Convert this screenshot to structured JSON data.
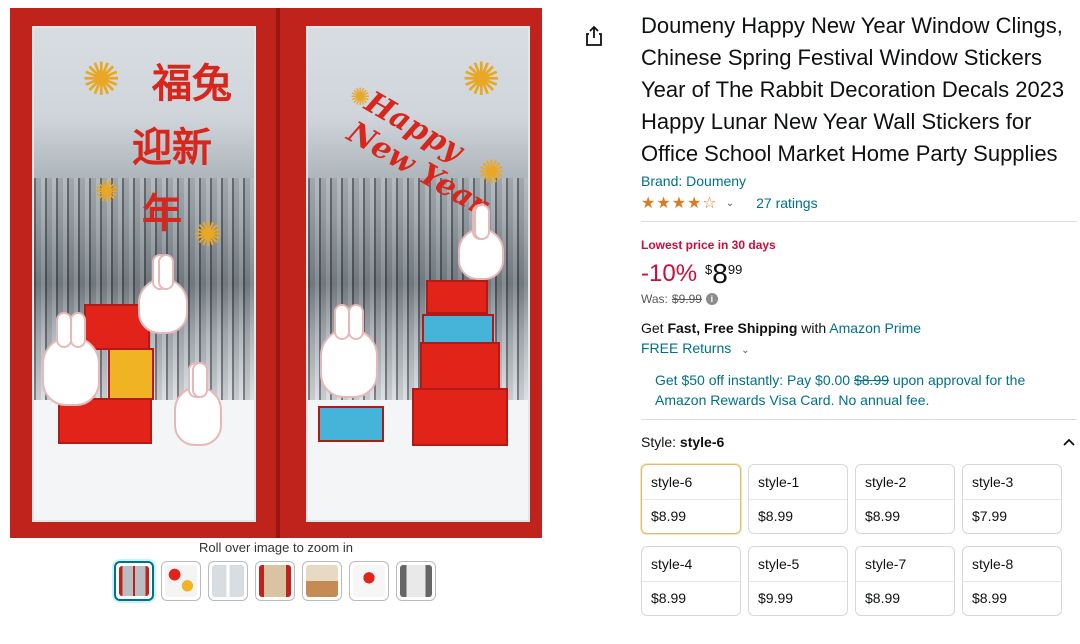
{
  "product": {
    "title": "Doumeny Happy New Year Window Clings, Chinese Spring Festival Window Stickers Year of The Rabbit Decoration Decals 2023 Happy Lunar New Year Wall Stickers for Office School Market Home Party Supplies",
    "brand": "Brand: Doumeny",
    "rating_stars": "★★★★☆",
    "rating_value": 4.3,
    "ratings_count": "27 ratings"
  },
  "gallery": {
    "zoom_caption": "Roll over image to zoom in",
    "left_door_text_1": "福兔",
    "left_door_text_2": "迎新",
    "left_door_text_3": "年",
    "right_door_text": "Happy New Year",
    "thumbnails": [
      "thumb-1",
      "thumb-2",
      "thumb-3",
      "thumb-4",
      "thumb-5",
      "thumb-6",
      "thumb-7"
    ]
  },
  "pricing": {
    "deal_label": "Lowest price in 30 days",
    "discount": "-10%",
    "currency": "$",
    "whole": "8",
    "fraction": "99",
    "was_label": "Was:",
    "was_price": "$9.99"
  },
  "shipping": {
    "prefix": "Get ",
    "bold": "Fast, Free Shipping",
    "middle": " with ",
    "prime_link": "Amazon Prime",
    "returns": "FREE Returns"
  },
  "promo": {
    "part1": "Get $50 off instantly: Pay $0.00 ",
    "strike": "$8.99",
    "part2": " upon approval for the Amazon Rewards Visa Card. No annual fee."
  },
  "style": {
    "label": "Style: ",
    "selected": "style-6",
    "options": [
      {
        "name": "style-6",
        "price": "$8.99"
      },
      {
        "name": "style-1",
        "price": "$8.99"
      },
      {
        "name": "style-2",
        "price": "$8.99"
      },
      {
        "name": "style-3",
        "price": "$7.99"
      },
      {
        "name": "style-4",
        "price": "$8.99"
      },
      {
        "name": "style-5",
        "price": "$9.99"
      },
      {
        "name": "style-7",
        "price": "$8.99"
      },
      {
        "name": "style-8",
        "price": "$8.99"
      }
    ]
  },
  "colors": {
    "link": "#007185",
    "deal_red": "#cc0c39",
    "star": "#de7921",
    "frame_red": "#c0221c"
  },
  "icons": {
    "share": "share-icon",
    "chevron": "chevron-down-icon",
    "caret": "chevron-up-icon",
    "info": "info-icon"
  }
}
